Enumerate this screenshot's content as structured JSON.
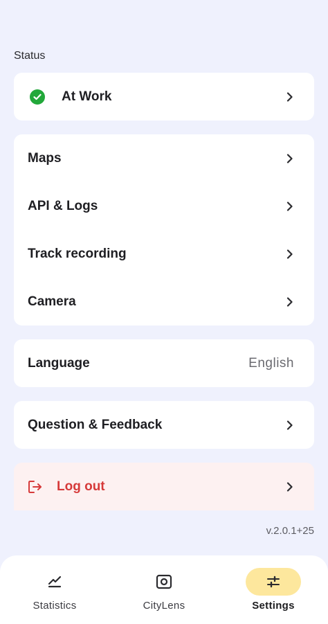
{
  "status": {
    "section_label": "Status",
    "current": "At Work",
    "color": "#22a83a"
  },
  "menu": {
    "items": [
      {
        "label": "Maps"
      },
      {
        "label": "API & Logs"
      },
      {
        "label": "Track recording"
      },
      {
        "label": "Camera"
      }
    ]
  },
  "language": {
    "label": "Language",
    "value": "English"
  },
  "feedback": {
    "label": "Question & Feedback"
  },
  "logout": {
    "label": "Log out",
    "color": "#d63a3a"
  },
  "version": "v.2.0.1+25",
  "nav": {
    "items": [
      {
        "label": "Statistics",
        "icon": "chart-line-icon"
      },
      {
        "label": "CityLens",
        "icon": "camera-icon"
      },
      {
        "label": "Settings",
        "icon": "sliders-icon",
        "active": true
      }
    ],
    "active_color": "#fde79d"
  }
}
